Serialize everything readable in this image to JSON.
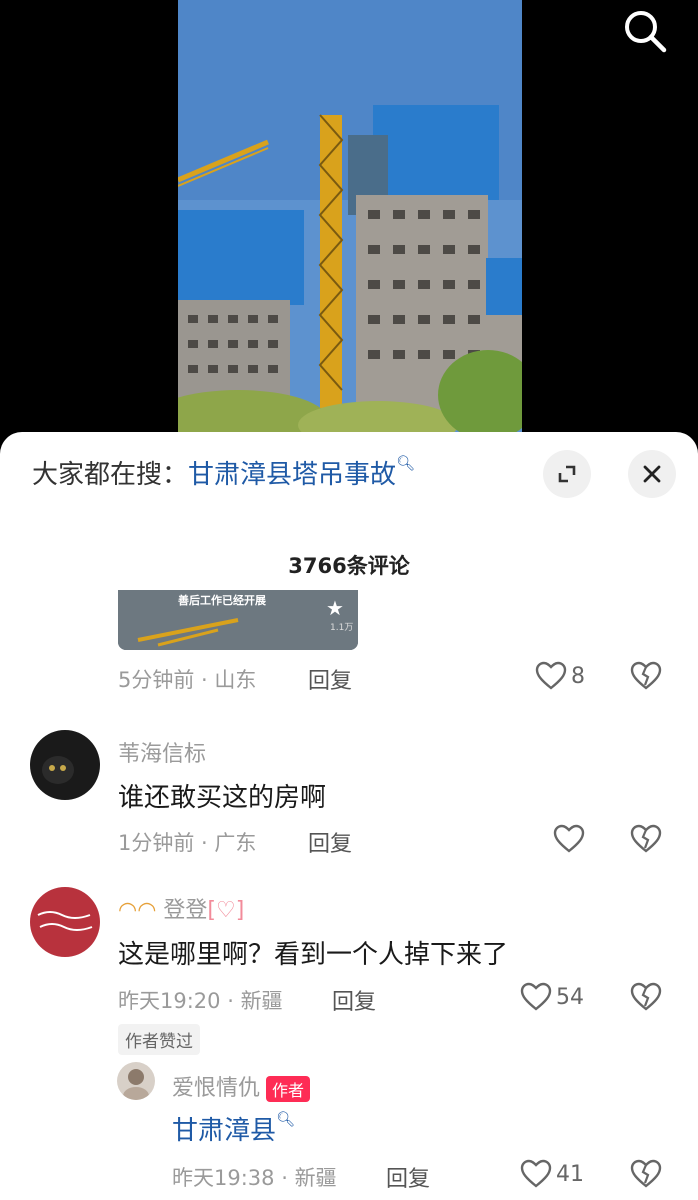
{
  "search_suggest": {
    "prefix": "大家都在搜：",
    "keyword": "甘肃漳县塔吊事故"
  },
  "comment_count": "3766条评论",
  "comments": [
    {
      "thumb_caption": "善后工作已经开展",
      "thumb_views": "1.1万",
      "time": "5分钟前",
      "location": "山东",
      "reply_label": "回复",
      "likes": "8"
    },
    {
      "user": "苇海信标",
      "text": "谁还敢买这的房啊",
      "time": "1分钟前",
      "location": "广东",
      "reply_label": "回复",
      "likes": ""
    },
    {
      "user": "登登",
      "text": "这是哪里啊？看到一个人掉下来了",
      "time": "昨天19:20",
      "location": "新疆",
      "reply_label": "回复",
      "likes": "54",
      "author_liked": "作者赞过",
      "reply": {
        "user": "爱恨情仇",
        "badge": "作者",
        "text": "甘肃漳县",
        "time": "昨天19:38",
        "location": "新疆",
        "reply_label": "回复",
        "likes": "41"
      }
    }
  ],
  "icons": {
    "search": "search-icon",
    "expand": "expand-icon",
    "close": "close-icon",
    "like": "heart-icon",
    "dislike": "broken-heart-icon"
  },
  "colors": {
    "accent": "#fe2c55",
    "link": "#1f5aa6"
  }
}
